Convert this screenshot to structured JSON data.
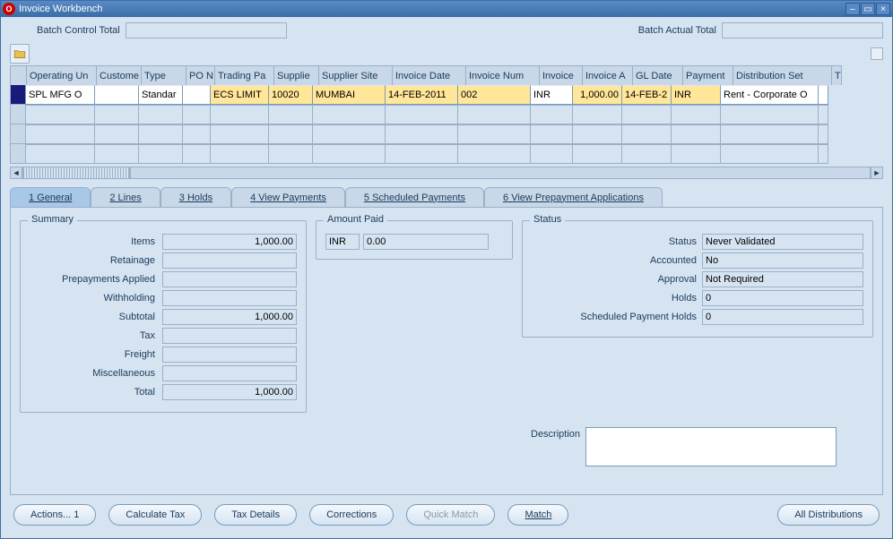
{
  "window": {
    "title": "Invoice Workbench"
  },
  "batch": {
    "control_label": "Batch Control Total",
    "actual_label": "Batch Actual Total",
    "control_value": "",
    "actual_value": ""
  },
  "grid": {
    "headers": [
      "Operating Un",
      "Custome",
      "Type",
      "PO N",
      "Trading Pa",
      "Supplie",
      "Supplier Site",
      "Invoice Date",
      "Invoice Num",
      "Invoice",
      "Invoice A",
      "GL Date",
      "Payment",
      "Distribution Set",
      "T"
    ],
    "row": {
      "operating_unit": "SPL MFG O",
      "customer": "",
      "type": "Standar",
      "po": "",
      "trading_partner": "ECS LIMIT",
      "supplier": "10020",
      "supplier_site": "MUMBAI",
      "invoice_date": "14-FEB-2011",
      "invoice_num": "002",
      "invoice_curr": "INR",
      "invoice_amount": "1,000.00",
      "gl_date": "14-FEB-2",
      "payment_curr": "INR",
      "distribution_set": "Rent - Corporate O"
    }
  },
  "tabs": {
    "general": "1 General",
    "lines": "2 Lines",
    "holds": "3 Holds",
    "view_payments": "4 View Payments",
    "scheduled_payments": "5 Scheduled Payments",
    "prepayment": "6 View Prepayment Applications"
  },
  "summary": {
    "legend": "Summary",
    "labels": {
      "items": "Items",
      "retainage": "Retainage",
      "prepayments": "Prepayments Applied",
      "withholding": "Withholding",
      "subtotal": "Subtotal",
      "tax": "Tax",
      "freight": "Freight",
      "misc": "Miscellaneous",
      "total": "Total"
    },
    "values": {
      "items": "1,000.00",
      "retainage": "",
      "prepayments": "",
      "withholding": "",
      "subtotal": "1,000.00",
      "tax": "",
      "freight": "",
      "misc": "",
      "total": "1,000.00"
    }
  },
  "amount_paid": {
    "legend": "Amount Paid",
    "curr": "INR",
    "value": "0.00"
  },
  "status": {
    "legend": "Status",
    "labels": {
      "status": "Status",
      "accounted": "Accounted",
      "approval": "Approval",
      "holds": "Holds",
      "sph": "Scheduled Payment Holds"
    },
    "values": {
      "status": "Never Validated",
      "accounted": "No",
      "approval": "Not Required",
      "holds": "0",
      "sph": "0"
    }
  },
  "description": {
    "label": "Description",
    "value": ""
  },
  "buttons": {
    "actions": "Actions... 1",
    "calc_tax": "Calculate Tax",
    "tax_details": "Tax Details",
    "corrections": "Corrections",
    "quick_match": "Quick Match",
    "match": "Match",
    "all_dist": "All Distributions"
  }
}
